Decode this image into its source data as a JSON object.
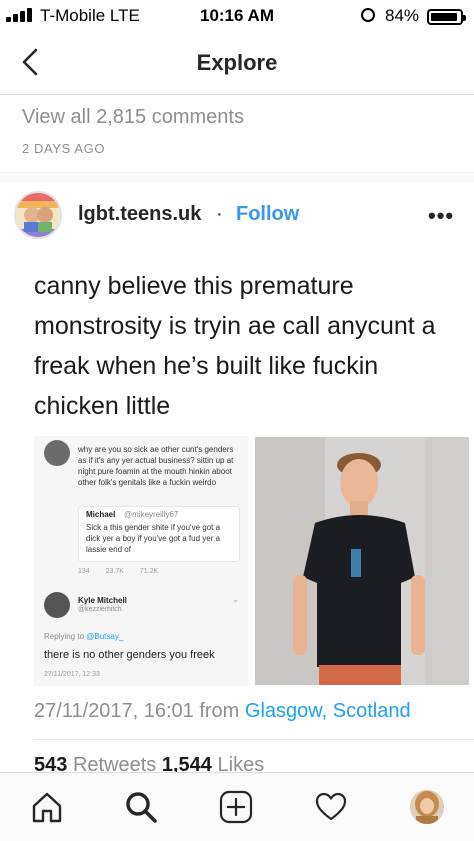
{
  "status_bar": {
    "carrier": "T-Mobile  LTE",
    "time": "10:16 AM",
    "battery": "84%",
    "battery_level": 0.84,
    "signal_bars": 4
  },
  "header": {
    "title": "Explore",
    "back_icon": "chevron-left-icon"
  },
  "comments": {
    "view_all": "View all 2,815 comments",
    "timestamp": "2 DAYS AGO"
  },
  "post": {
    "username": "lgbt.teens.uk",
    "separator": "·",
    "follow_label": "Follow",
    "more_label": "•••",
    "tweet": {
      "text": "canny believe this premature monstrosity is tryin ae call anycunt a freak when he’s built like fuckin chicken little",
      "quoted": {
        "text": "why are you so sick ae other cunt's genders as if it's any yer actual business? sittin up at night pure foamin at the mouth hinkin aboot other folk's genitals like a fuckin weirdo",
        "inner_name": "Michael",
        "inner_handle": "@mikeyreilly67",
        "inner_text": "Sick a this gender shite if you've got a dick yer a boy if you've got a fud yer a lassie end of",
        "stats": [
          "134",
          "23.7K",
          "71.2K"
        ]
      },
      "reply": {
        "name": "Kyle Mitchell",
        "handle": "@kezziemitch",
        "replying_prefix": "Replying to",
        "replying_to": "@Butsay_",
        "text": "there is no other genders you freek",
        "date": "27/11/2017, 12:33"
      },
      "date": "27/11/2017, 16:01 from",
      "location": "Glasgow, Scotland",
      "retweets_count": "543",
      "retweets_label": "Retweets",
      "likes_count": "1,544",
      "likes_label": "Likes"
    }
  },
  "tabbar": {
    "items": [
      "home-icon",
      "search-icon",
      "add-post-icon",
      "heart-icon",
      "profile-avatar"
    ]
  },
  "colors": {
    "link": "#3897f0",
    "twitter_blue": "#1da1f2",
    "muted": "#8e8e8e"
  }
}
